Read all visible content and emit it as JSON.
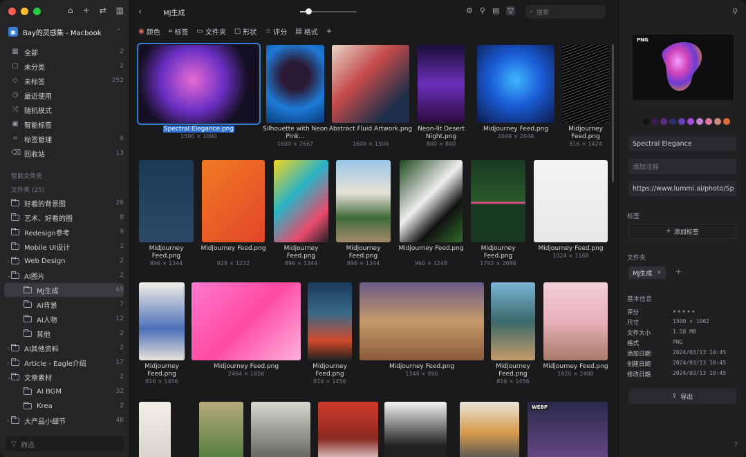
{
  "sidebar": {
    "library": "Bay的灵感集 - Macbook",
    "nav": [
      {
        "label": "全部",
        "count": "2"
      },
      {
        "label": "未分类",
        "count": "2"
      },
      {
        "label": "未标签",
        "count": "252"
      },
      {
        "label": "最近使用",
        "count": ""
      },
      {
        "label": "随机模式",
        "count": ""
      },
      {
        "label": "智能标签",
        "count": ""
      },
      {
        "label": "标签管理",
        "count": "6"
      },
      {
        "label": "回收站",
        "count": "13"
      }
    ],
    "smart_folders_heading": "智能文件夹",
    "folders_heading": "文件夹 (25)",
    "folders": [
      {
        "label": "好看的背景图",
        "count": "28",
        "indent": 0,
        "caret": "",
        "selected": false
      },
      {
        "label": "艺术、好看的图",
        "count": "8",
        "indent": 0,
        "caret": "",
        "selected": false
      },
      {
        "label": "Redesign参考",
        "count": "9",
        "indent": 0,
        "caret": "",
        "selected": false
      },
      {
        "label": "Mobile UI设计",
        "count": "2",
        "indent": 0,
        "caret": "",
        "selected": false
      },
      {
        "label": "Web Design",
        "count": "2",
        "indent": 0,
        "caret": "›",
        "selected": false
      },
      {
        "label": "AI图片",
        "count": "2",
        "indent": 0,
        "caret": "⌄",
        "selected": false
      },
      {
        "label": "MJ生成",
        "count": "65",
        "indent": 1,
        "caret": "",
        "selected": true
      },
      {
        "label": "AI背景",
        "count": "7",
        "indent": 1,
        "caret": "",
        "selected": false
      },
      {
        "label": "AI人物",
        "count": "12",
        "indent": 1,
        "caret": "",
        "selected": false
      },
      {
        "label": "其他",
        "count": "2",
        "indent": 1,
        "caret": "",
        "selected": false
      },
      {
        "label": "AI其他资料",
        "count": "2",
        "indent": 0,
        "caret": "›",
        "selected": false
      },
      {
        "label": "Article - Eagle介绍",
        "count": "17",
        "indent": 0,
        "caret": "›",
        "selected": false
      },
      {
        "label": "文章素材",
        "count": "2",
        "indent": 0,
        "caret": "⌄",
        "selected": false
      },
      {
        "label": "AI BGM",
        "count": "32",
        "indent": 1,
        "caret": "",
        "selected": false
      },
      {
        "label": "Krea",
        "count": "2",
        "indent": 1,
        "caret": "",
        "selected": false
      },
      {
        "label": "大产品小细节",
        "count": "48",
        "indent": 0,
        "caret": "›",
        "selected": false
      }
    ],
    "filter_placeholder": "筛选"
  },
  "main": {
    "title": "MJ生成",
    "zoom_level": 0.15,
    "search_placeholder": "搜索",
    "filters": [
      "颜色",
      "标签",
      "文件夹",
      "形状",
      "评分",
      "格式"
    ],
    "items": [
      {
        "name": "Spectral Elegance.png",
        "dims": "1500 × 1000",
        "selected": true
      },
      {
        "name": "Silhouette with Neon Pink...",
        "dims": "1600 × 2667",
        "selected": false
      },
      {
        "name": "Abstract Fluid Artwork.png",
        "dims": "1600 × 1500",
        "selected": false
      },
      {
        "name": "Neon-lit Desert Night.png",
        "dims": "800 × 800",
        "selected": false
      },
      {
        "name": "Midjourney Feed.png",
        "dims": "2048 × 2048",
        "selected": false
      },
      {
        "name": "Midjourney Feed.png",
        "dims": "816 × 1424",
        "selected": false
      },
      {
        "name": "Midjourney Feed.png",
        "dims": "896 × 1344",
        "selected": false
      },
      {
        "name": "Midjourney Feed.png",
        "dims": "928 × 1232",
        "selected": false
      },
      {
        "name": "Midjourney Feed.png",
        "dims": "896 × 1344",
        "selected": false
      },
      {
        "name": "Midjourney Feed.png",
        "dims": "896 × 1344",
        "selected": false
      },
      {
        "name": "Midjourney Feed.png",
        "dims": "960 × 1248",
        "selected": false
      },
      {
        "name": "Midjourney Feed.png",
        "dims": "1792 × 2688",
        "selected": false
      },
      {
        "name": "Midjourney Feed.png",
        "dims": "1024 × 1168",
        "selected": false
      },
      {
        "name": "Midjourney Feed.png",
        "dims": "816 × 1456",
        "selected": false
      },
      {
        "name": "Midjourney Feed.png",
        "dims": "2464 × 1856",
        "selected": false
      },
      {
        "name": "Midjourney Feed.png",
        "dims": "816 × 1456",
        "selected": false
      },
      {
        "name": "Midjourney Feed.png",
        "dims": "1344 × 896",
        "selected": false
      },
      {
        "name": "Midjourney Feed.png",
        "dims": "816 × 1456",
        "selected": false
      },
      {
        "name": "Midjourney Feed.png",
        "dims": "1920 × 2400",
        "selected": false
      }
    ],
    "row4_badge": "WEBP"
  },
  "inspector": {
    "format_badge": "PNG",
    "title_value": "Spectral Elegance",
    "note_placeholder": "添加注释",
    "url_value": "https://www.lummi.ai/photo/Sp",
    "tags_label": "标签",
    "add_tag_label": "添加标签",
    "folder_label": "文件夹",
    "folder_chip": "MJ生成",
    "basic_info_label": "基本信息",
    "info": [
      {
        "k": "评分",
        "v": "★★★★★"
      },
      {
        "k": "尺寸",
        "v": "1500 × 1002"
      },
      {
        "k": "文件大小",
        "v": "1.58 MB"
      },
      {
        "k": "格式",
        "v": "PNG"
      },
      {
        "k": "添加日期",
        "v": "2024/03/13 10:45"
      },
      {
        "k": "创建日期",
        "v": "2024/03/13 10:45"
      },
      {
        "k": "修改日期",
        "v": "2024/03/13 10:45"
      }
    ],
    "export_label": "导出",
    "swatch_colors": [
      "#111111",
      "#3a1b4a",
      "#5b2a7e",
      "#2a2e6e",
      "#6a3fb5",
      "#a44ed8",
      "#c77fd6",
      "#e07aa5",
      "#d38a7d",
      "#e06b3a"
    ]
  }
}
